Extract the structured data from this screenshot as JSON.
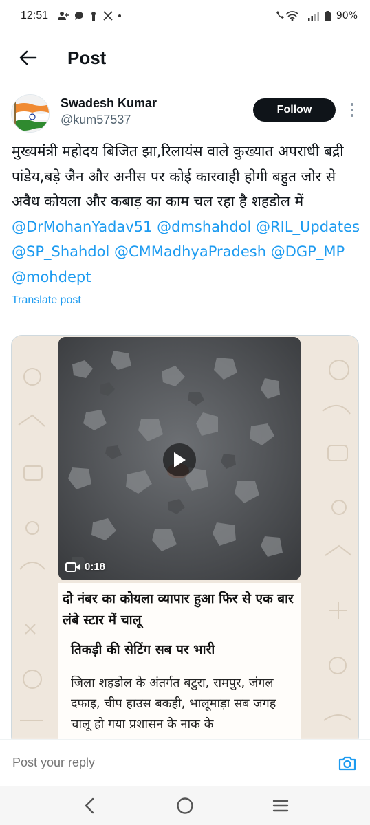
{
  "status_bar": {
    "time": "12:51",
    "notification_icons": [
      "person-add-icon",
      "chat-bubble-icon",
      "pin-icon",
      "x-logo-icon"
    ],
    "battery": "90%",
    "colors": {
      "text": "#1c1c1c"
    }
  },
  "header": {
    "title": "Post",
    "back_icon": "arrow-left-icon"
  },
  "author": {
    "name": "Swadesh Kumar",
    "handle": "@kum57537",
    "follow_label": "Follow",
    "avatar_icon": "india-flag-avatar"
  },
  "post": {
    "text_plain": "मुख्यमंत्री महोदय बिजित झा,रिलायंस वाले कुख्यात अपराधी बद्री पांडेय,बड़े जैन और अनीस पर कोई कारवाही होगी बहुत जोर से अवैध कोयला और कबाड़ का काम चल रहा है शहडोल में ",
    "mentions": [
      "@DrMohanYadav51",
      "@dmshahdol",
      "@RIL_Updates",
      "@SP_Shahdol",
      "@CMMadhyaPradesh",
      "@DGP_MP",
      "@mohdept"
    ],
    "translate_label": "Translate post",
    "colors": {
      "mention": "#1d9bf0"
    }
  },
  "media": {
    "video_duration": "0:18",
    "article_headline": "दो नंबर का कोयला व्यापार हुआ फिर से एक बार लंबे स्टार में चालू",
    "article_subhead": "तिकड़ी की सेटिंग सब पर भारी",
    "article_body": "जिला शहडोल के अंतर्गत बटुरा, रामपुर, जंगल दफाइ, चीप हाउस बकही, भालूमाड़ा सब जगह चालू हो गया प्रशासन के नाक के"
  },
  "reply": {
    "placeholder": "Post your reply",
    "camera_icon": "camera-icon"
  },
  "nav": {
    "back_icon": "nav-back-icon",
    "home_icon": "nav-home-icon",
    "recents_icon": "nav-recents-icon"
  }
}
